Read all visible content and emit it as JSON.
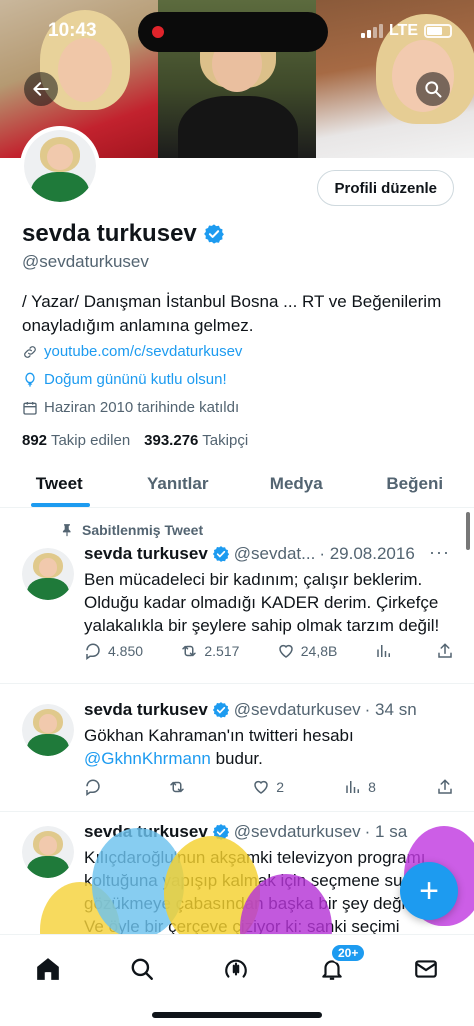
{
  "status_bar": {
    "time": "10:43",
    "network": "LTE"
  },
  "header": {
    "back_icon": "arrow-left-icon",
    "search_icon": "search-icon"
  },
  "profile": {
    "edit_button": "Profili düzenle",
    "name": "sevda turkusev",
    "handle": "@sevdaturkusev",
    "bio": "/ Yazar/ Danışman İstanbul Bosna ... RT ve Beğenilerim onayladığım anlamına gelmez.",
    "website": "youtube.com/c/sevdaturkusev",
    "birthday": "Doğum gününü kutlu olsun!",
    "joined": "Haziran 2010 tarihinde katıldı",
    "following_count": "892",
    "following_label": "Takip edilen",
    "followers_count": "393.276",
    "followers_label": "Takipçi"
  },
  "tabs": [
    {
      "label": "Tweet",
      "active": true
    },
    {
      "label": "Yanıtlar",
      "active": false
    },
    {
      "label": "Medya",
      "active": false
    },
    {
      "label": "Beğeni",
      "active": false
    }
  ],
  "tweets": [
    {
      "pinned_label": "Sabitlenmiş Tweet",
      "name": "sevda turkusev",
      "handle": "@sevdat...",
      "time": "· 29.08.2016",
      "text": "Ben mücadeleci bir kadınım; çalışır beklerim. Olduğu kadar olmadığı KADER derim. Çirkefçe yalakalıkla bir şeylere sahip olmak tarzım değil!",
      "replies": "4.850",
      "retweets": "2.517",
      "likes": "24,8B",
      "views": ""
    },
    {
      "name": "sevda turkusev",
      "handle": "@sevdaturkusev",
      "time": "· 34 sn",
      "text_before": "Gökhan Kahraman'ın twitteri hesabı",
      "mention": "@GkhnKhrmann",
      "text_after": " budur.",
      "replies": "",
      "retweets": "",
      "likes": "2",
      "views": "8"
    },
    {
      "name": "sevda turkusev",
      "handle": "@sevdaturkusev",
      "time": "· 1 sa",
      "line1": "Kılıçdaroğlu'nun akşamki televizyon programı",
      "line2": "koltuğuna yapışıp kalmak için seçmene sunu",
      "line3": "gözükmeye çabasından başka bir şey değil.",
      "line4": "Ve öyle bir çerçeve çiziyor ki: sanki seçimi"
    }
  ],
  "fab_label": "+",
  "bottom_nav": {
    "notification_badge": "20+"
  }
}
